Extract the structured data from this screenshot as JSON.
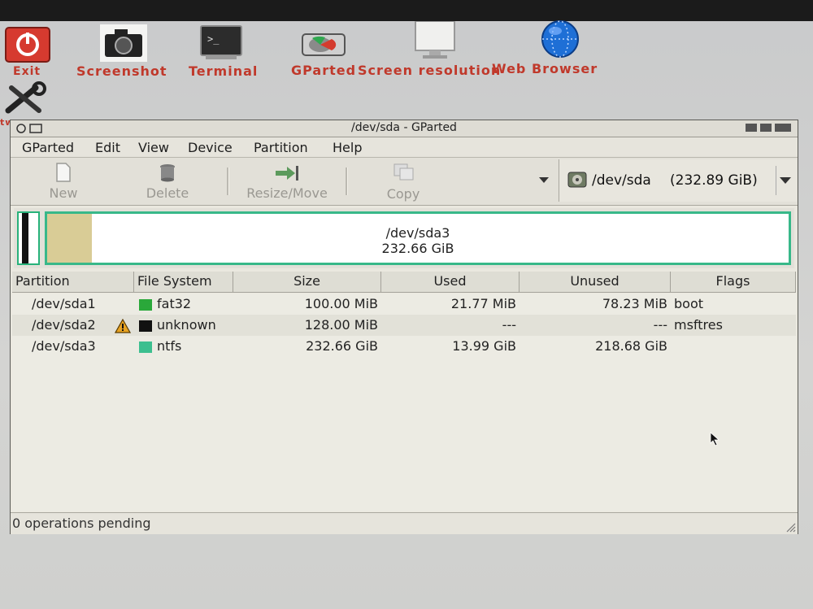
{
  "desktop": {
    "icons": [
      {
        "name": "exit",
        "label": "Exit"
      },
      {
        "name": "screenshot",
        "label": "Screenshot"
      },
      {
        "name": "terminal",
        "label": "Terminal"
      },
      {
        "name": "gparted",
        "label": "GParted"
      },
      {
        "name": "screen-resolution",
        "label": "Screen resolution"
      },
      {
        "name": "web-browser",
        "label": "Web Browser"
      }
    ],
    "partial_label": "tw"
  },
  "window": {
    "title": "/dev/sda - GParted",
    "menu": [
      "GParted",
      "Edit",
      "View",
      "Device",
      "Partition",
      "Help"
    ],
    "toolbar": {
      "new": "New",
      "delete": "Delete",
      "resize": "Resize/Move",
      "copy": "Copy"
    },
    "device_selector": {
      "device": "/dev/sda",
      "size": "(232.89 GiB)"
    },
    "graph": {
      "partition": "/dev/sda3",
      "size": "232.66 GiB"
    },
    "columns": [
      "Partition",
      "File System",
      "Size",
      "Used",
      "Unused",
      "Flags"
    ],
    "rows": [
      {
        "partition": "/dev/sda1",
        "fs": "fat32",
        "size": "100.00 MiB",
        "used": "21.77 MiB",
        "unused": "78.23 MiB",
        "flags": "boot",
        "warning": false,
        "color": "#2aa83a"
      },
      {
        "partition": "/dev/sda2",
        "fs": "unknown",
        "size": "128.00 MiB",
        "used": "---",
        "unused": "---",
        "flags": "msftres",
        "warning": true,
        "color": "#111111"
      },
      {
        "partition": "/dev/sda3",
        "fs": "ntfs",
        "size": "232.66 GiB",
        "used": "13.99 GiB",
        "unused": "218.68 GiB",
        "flags": "",
        "warning": false,
        "color": "#3cbf8f"
      }
    ],
    "status": "0 operations pending"
  }
}
